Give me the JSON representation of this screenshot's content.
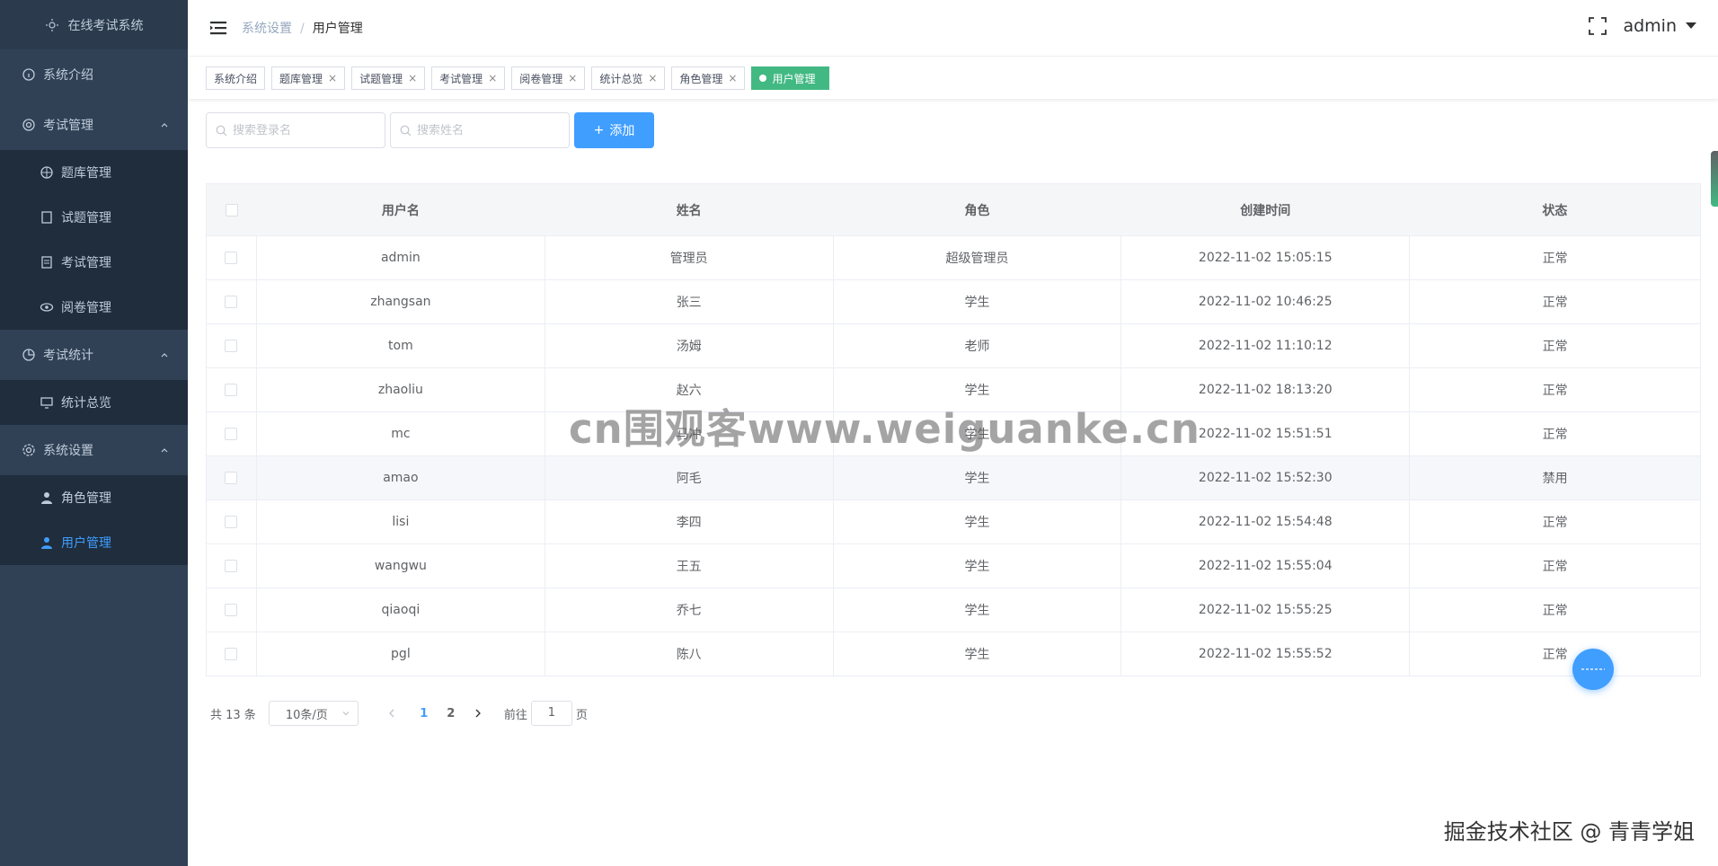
{
  "sidebar": {
    "logo": "在线考试系统",
    "items": [
      {
        "label": "系统介绍",
        "icon": "info-icon"
      },
      {
        "label": "考试管理",
        "icon": "gear-circle-icon"
      },
      {
        "label": "题库管理",
        "icon": "target-icon"
      },
      {
        "label": "试题管理",
        "icon": "file-edit-icon"
      },
      {
        "label": "考试管理",
        "icon": "document-icon"
      },
      {
        "label": "阅卷管理",
        "icon": "eye-icon"
      },
      {
        "label": "考试统计",
        "icon": "pie-chart-icon"
      },
      {
        "label": "统计总览",
        "icon": "monitor-icon"
      },
      {
        "label": "系统设置",
        "icon": "settings-icon"
      },
      {
        "label": "角色管理",
        "icon": "user-icon"
      },
      {
        "label": "用户管理",
        "icon": "user-icon"
      }
    ]
  },
  "navbar": {
    "breadcrumb": [
      "系统设置",
      "用户管理"
    ],
    "user": "admin"
  },
  "tags": [
    {
      "label": "系统介绍"
    },
    {
      "label": "题库管理"
    },
    {
      "label": "试题管理"
    },
    {
      "label": "考试管理"
    },
    {
      "label": "阅卷管理"
    },
    {
      "label": "统计总览"
    },
    {
      "label": "角色管理"
    },
    {
      "label": "用户管理"
    }
  ],
  "toolbar": {
    "search_login_placeholder": "搜索登录名",
    "search_name_placeholder": "搜索姓名",
    "add_label": "添加"
  },
  "table": {
    "headers": [
      "用户名",
      "姓名",
      "角色",
      "创建时间",
      "状态"
    ],
    "rows": [
      [
        "admin",
        "管理员",
        "超级管理员",
        "2022-11-02 15:05:15",
        "正常"
      ],
      [
        "zhangsan",
        "张三",
        "学生",
        "2022-11-02 10:46:25",
        "正常"
      ],
      [
        "tom",
        "汤姆",
        "老师",
        "2022-11-02 11:10:12",
        "正常"
      ],
      [
        "zhaoliu",
        "赵六",
        "学生",
        "2022-11-02 18:13:20",
        "正常"
      ],
      [
        "mc",
        "马冲",
        "学生",
        "2022-11-02 15:51:51",
        "正常"
      ],
      [
        "amao",
        "阿毛",
        "学生",
        "2022-11-02 15:52:30",
        "禁用"
      ],
      [
        "lisi",
        "李四",
        "学生",
        "2022-11-02 15:54:48",
        "正常"
      ],
      [
        "wangwu",
        "王五",
        "学生",
        "2022-11-02 15:55:04",
        "正常"
      ],
      [
        "qiaoqi",
        "乔七",
        "学生",
        "2022-11-02 15:55:25",
        "正常"
      ],
      [
        "pgl",
        "陈八",
        "学生",
        "2022-11-02 15:55:52",
        "正常"
      ]
    ]
  },
  "pager": {
    "total": "共 13 条",
    "page_size": "10条/页",
    "pages": [
      "1",
      "2"
    ],
    "goto_prefix": "前往",
    "goto_value": "1",
    "goto_suffix": "页"
  },
  "watermark": "cn围观客www.weiguanke.cn",
  "credit": "掘金技术社区 @ 青青学姐",
  "colors": {
    "sidebar": "#304156",
    "accent": "#409eff",
    "active_tag": "#42b983"
  }
}
